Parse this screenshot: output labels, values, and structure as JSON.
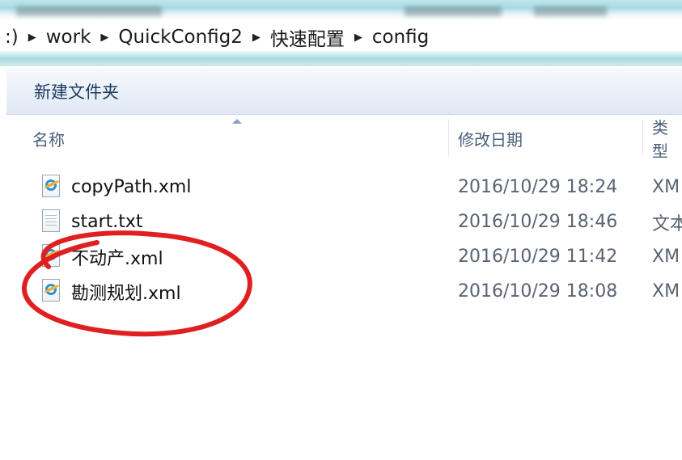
{
  "address_bar": {
    "crumbs": [
      ":)",
      "work",
      "QuickConfig2",
      "快速配置",
      "config"
    ],
    "separator": "▶"
  },
  "toolbar": {
    "new_folder_label": "新建文件夹"
  },
  "columns": {
    "name": "名称",
    "date_modified": "修改日期",
    "type": "类型"
  },
  "files": [
    {
      "name": "copyPath.xml",
      "date": "2016/10/29 18:24",
      "type": "XM",
      "icon": "ie-xml-icon"
    },
    {
      "name": "start.txt",
      "date": "2016/10/29 18:46",
      "type": "文本",
      "icon": "text-file-icon"
    },
    {
      "name": "不动产.xml",
      "date": "2016/10/29 11:42",
      "type": "XM",
      "icon": "ie-xml-icon"
    },
    {
      "name": "勘测规划.xml",
      "date": "2016/10/29 18:08",
      "type": "XM",
      "icon": "ie-xml-icon"
    }
  ],
  "colors": {
    "annotation": "#e02020",
    "toolbar_text": "#1e3a5f",
    "header_text": "#4c607a"
  }
}
